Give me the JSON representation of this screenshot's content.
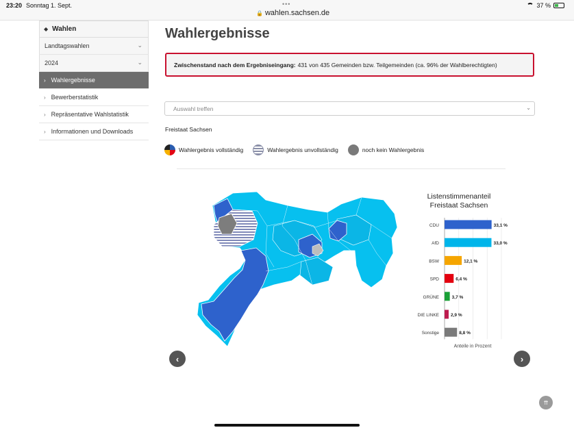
{
  "statusbar": {
    "time": "23:20",
    "date": "Sonntag 1. Sept.",
    "dots": "•••",
    "url": "wahlen.sachsen.de",
    "battery": "37 %"
  },
  "sidebar": {
    "head": "Wahlen",
    "dropdowns": [
      {
        "label": "Landtagswahlen"
      },
      {
        "label": "2024"
      }
    ],
    "items": [
      {
        "label": "Wahlergebnisse",
        "active": true
      },
      {
        "label": "Bewerberstatistik",
        "active": false
      },
      {
        "label": "Repräsentative Wahlstatistik",
        "active": false
      },
      {
        "label": "Informationen und Downloads",
        "active": false
      }
    ]
  },
  "main": {
    "title": "Wahlergebnisse",
    "alert_bold": "Zwischenstand nach dem Ergebniseingang:",
    "alert_text": "431 von 435 Gemeinden bzw. Teilgemeinden (ca. 96% der Wahlberechtigten)",
    "select_placeholder": "Auswahl treffen",
    "region": "Freistaat Sachsen",
    "legend": [
      {
        "label": "Wahlergebnis vollständig",
        "icon": "full-result-icon"
      },
      {
        "label": "Wahlergebnis unvollständig",
        "icon": "partial-result-icon"
      },
      {
        "label": "noch kein Wahlergebnis",
        "icon": "no-result-icon"
      }
    ]
  },
  "chart_data": {
    "type": "bar",
    "orientation": "horizontal",
    "title": "Listenstimmenanteil",
    "subtitle": "Freistaat Sachsen",
    "xlabel": "Anteile in Prozent",
    "categories": [
      "CDU",
      "AfD",
      "BSW",
      "SPD",
      "GRÜNE",
      "DIE LINKE",
      "Sonstige"
    ],
    "values": [
      33.1,
      33.0,
      12.1,
      6.4,
      3.7,
      2.9,
      8.8
    ],
    "value_labels": [
      "33,1 %",
      "33,0 %",
      "12,1 %",
      "6,4 %",
      "3,7 %",
      "2,9 %",
      "8,8 %"
    ],
    "colors": [
      "#2e62cc",
      "#00b5ea",
      "#f5a500",
      "#e3000f",
      "#1aa037",
      "#be1c4f",
      "#7a7a7a"
    ],
    "xlim": [
      0,
      40
    ],
    "grid": true
  },
  "colors": {
    "cdu": "#2e62cc",
    "afd": "#00bfee",
    "alert_border": "#c8102e",
    "active_nav": "#6d6d6d"
  }
}
